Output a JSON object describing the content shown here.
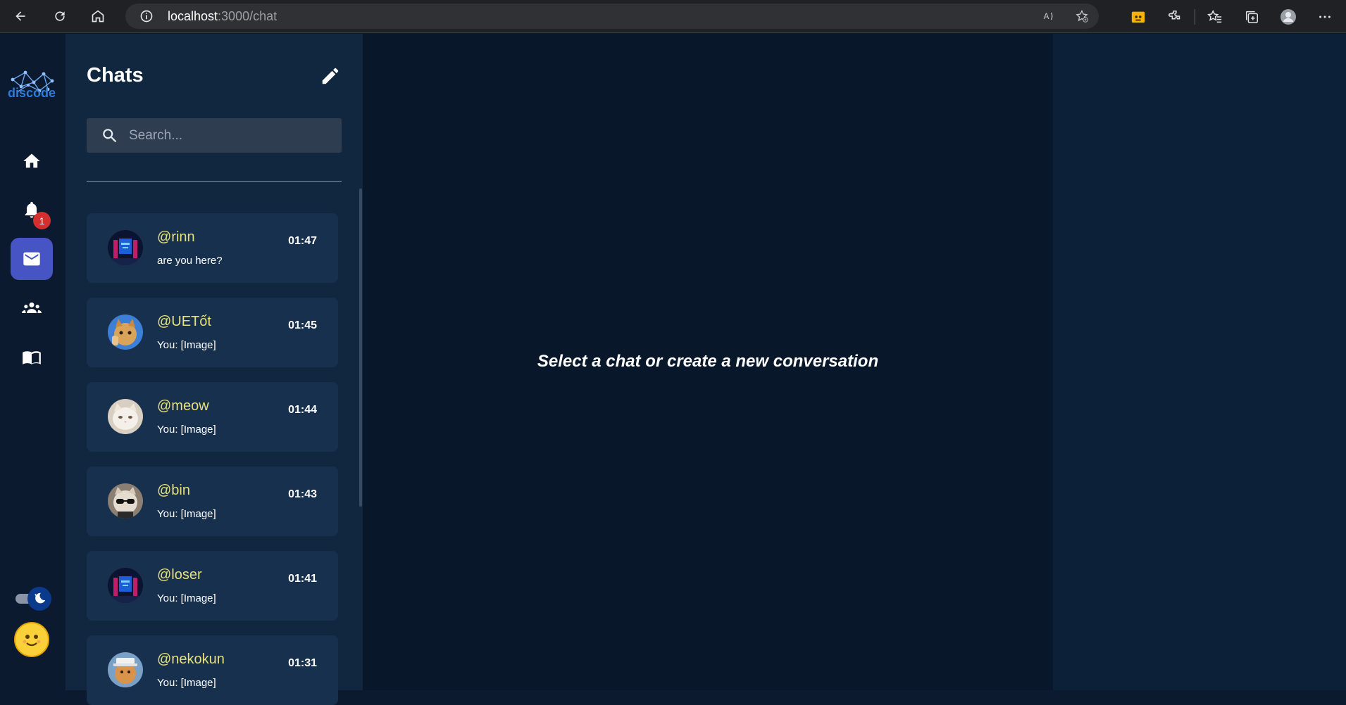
{
  "browser": {
    "url_host": "localhost",
    "url_path": ":3000/chat"
  },
  "app": {
    "logo_text": "discode",
    "notification_count": "1"
  },
  "chat_panel": {
    "title": "Chats",
    "search_placeholder": "Search...",
    "items": [
      {
        "name": "@rinn",
        "time": "01:47",
        "preview": "are you here?",
        "avatar": "neon-room"
      },
      {
        "name": "@UETốt",
        "time": "01:45",
        "preview": "You: [Image]",
        "avatar": "cat-thumbs"
      },
      {
        "name": "@meow",
        "time": "01:44",
        "preview": "You: [Image]",
        "avatar": "white-cat"
      },
      {
        "name": "@bin",
        "time": "01:43",
        "preview": "You: [Image]",
        "avatar": "cat-sunglasses"
      },
      {
        "name": "@loser",
        "time": "01:41",
        "preview": "You: [Image]",
        "avatar": "neon-room"
      },
      {
        "name": "@nekokun",
        "time": "01:31",
        "preview": "You: [Image]",
        "avatar": "cat-hat"
      }
    ]
  },
  "main": {
    "empty_message": "Select a chat or create a new conversation"
  },
  "colors": {
    "accent": "#4754c4",
    "username": "#e6e07a",
    "badge": "#d32f2f"
  }
}
